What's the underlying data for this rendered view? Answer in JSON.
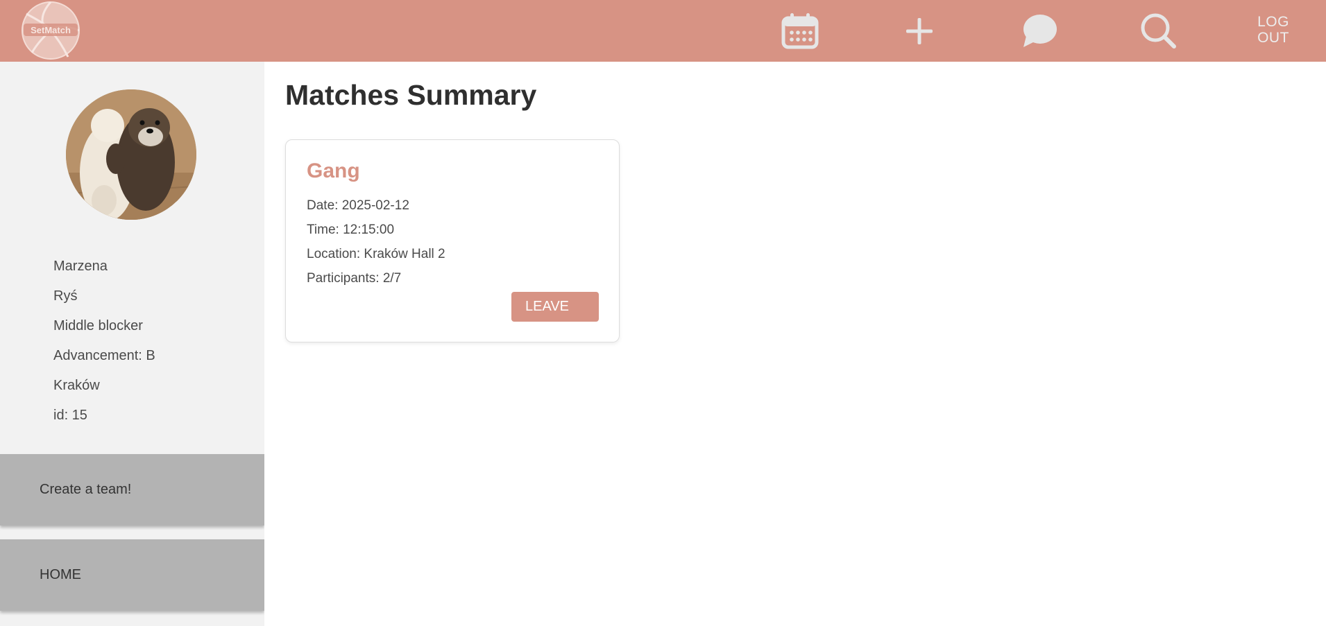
{
  "header": {
    "logo_text": "SetMatch",
    "nav": [
      {
        "icon": "calendar-icon"
      },
      {
        "icon": "plus-icon"
      },
      {
        "icon": "chat-icon"
      },
      {
        "icon": "search-icon"
      }
    ],
    "logout_line1": "LOG",
    "logout_line2": "OUT"
  },
  "sidebar": {
    "avatar": "otter-avatar",
    "profile": {
      "first_name": "Marzena",
      "last_name": "Ryś",
      "position": "Middle blocker",
      "advancement": "Advancement: B",
      "city": "Kraków",
      "id": "id: 15"
    },
    "create_team_label": "Create a team!",
    "home_label": "HOME"
  },
  "main": {
    "title": "Matches Summary",
    "matches": [
      {
        "name": "Gang",
        "date": "Date: 2025-02-12",
        "time": "Time: 12:15:00",
        "location": "Location: Kraków Hall 2",
        "participants": "Participants: 2/7",
        "action_label": "LEAVE"
      }
    ]
  },
  "colors": {
    "accent": "#d79384",
    "sidebar_bg": "#f2f2f2",
    "sidebar_button": "#b3b3b3",
    "icon_color": "#e6e6e6"
  }
}
